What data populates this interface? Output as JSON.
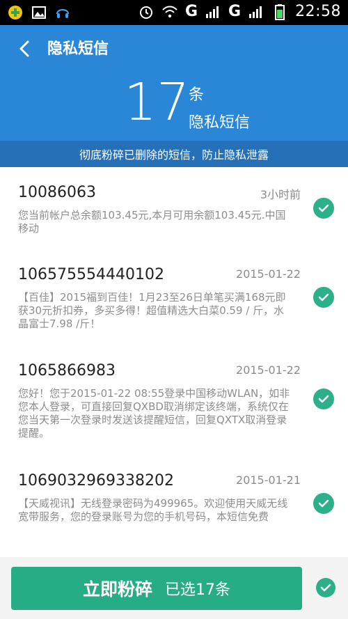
{
  "status_bar": {
    "time": "22:58",
    "net1": "G",
    "net2": "G",
    "icons": [
      "plus-app-icon",
      "image-icon",
      "assistant-icon",
      "alarm-icon",
      "wifi-icon",
      "signal-icon",
      "signal-icon",
      "battery-icon"
    ]
  },
  "header": {
    "title": "隐私短信",
    "count": "17",
    "count_unit": "条",
    "count_label": "隐私短信",
    "color": "#2a86d6"
  },
  "tip": "彻底粉碎已删除的短信，防止隐私泄露",
  "messages": [
    {
      "sender": "10086063",
      "time": "3小时前",
      "snippet": "您当前帐户总余额103.45元,本月可用余额103.45元.中国移动"
    },
    {
      "sender": "106575554440102",
      "time": "2015-01-22",
      "snippet": "【百佳】2015福到百佳！1月23至26日单笔买满168元即获30元折扣券，多买多得！超值精选大白菜0.59 / 斤，水晶富士7.98 /斤！"
    },
    {
      "sender": "1065866983",
      "time": "2015-01-22",
      "snippet": "您好！您于2015-01-22 08:55登录中国移动WLAN，如非您本人登录，可直接回复QXBD取消绑定该终端，系统仅在您当天第一次登录时发送该提醒短信，回复QXTX取消登录提醒。"
    },
    {
      "sender": "1069032969338202",
      "time": "2015-01-21",
      "snippet": "【天威视讯】无线登录密码为499965。欢迎使用天威无线宽带服务，您的登录账号为您的手机号码，本短信免费"
    }
  ],
  "action": {
    "button": "立即粉碎",
    "selected": "已选17条",
    "color": "#26ad86"
  }
}
